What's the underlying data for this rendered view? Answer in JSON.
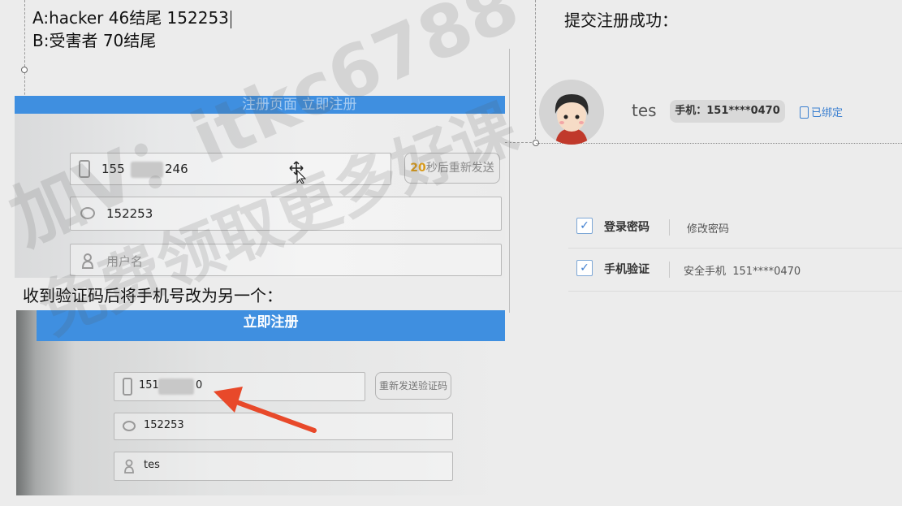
{
  "notes": {
    "line_a": "A:hacker 46结尾  152253",
    "line_b": "B:受害者 70结尾"
  },
  "headings": {
    "success": "提交注册成功：",
    "after_code": "收到验证码后将手机号改为另一个："
  },
  "panel1": {
    "bar_text": "注册页面  立即注册",
    "phone_prefix": "155",
    "phone_suffix": "246",
    "resend_seconds": "20",
    "resend_suffix": "秒后重新发送",
    "code_value": "152253",
    "username_placeholder": "用户名"
  },
  "panel2": {
    "register_label": "立即注册",
    "phone_prefix": "151",
    "phone_suffix": "0",
    "resend_label": "重新发送验证码",
    "code_value": "152253",
    "username_value": "tes"
  },
  "profile": {
    "username": "tes",
    "phone_label": "手机：151****0470",
    "bound_label": "已绑定"
  },
  "security": {
    "items": [
      {
        "label": "登录密码",
        "action": "修改密码"
      },
      {
        "label": "手机验证",
        "action": "安全手机  151****0470"
      }
    ]
  },
  "watermark": {
    "line1": "加V：itkc6788",
    "line2": "免费领取更多好课"
  },
  "colors": {
    "blue_bar": "#3f8fe0",
    "arrow": "#e8492a",
    "countdown": "#d89a1a",
    "link": "#3a7fd0"
  }
}
